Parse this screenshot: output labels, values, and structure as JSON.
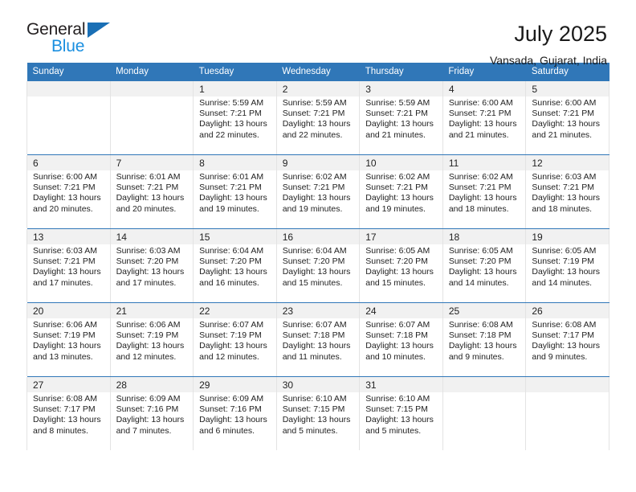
{
  "brand": {
    "name_part1": "General",
    "name_part2": "Blue",
    "triangle_color": "#1a6fb5",
    "blue_color": "#1a8fe0"
  },
  "header": {
    "title": "July 2025",
    "subtitle": "Vansada, Gujarat, India"
  },
  "theme": {
    "header_blue": "#3077b8",
    "daynum_background": "#f1f1f1",
    "cell_border": "#e3e3e3"
  },
  "weekdays": [
    "Sunday",
    "Monday",
    "Tuesday",
    "Wednesday",
    "Thursday",
    "Friday",
    "Saturday"
  ],
  "weeks": [
    {
      "days": [
        {
          "num": "",
          "lines": [
            "",
            "",
            "",
            ""
          ]
        },
        {
          "num": "",
          "lines": [
            "",
            "",
            "",
            ""
          ]
        },
        {
          "num": "1",
          "lines": [
            "Sunrise: 5:59 AM",
            "Sunset: 7:21 PM",
            "Daylight: 13 hours",
            "and 22 minutes."
          ]
        },
        {
          "num": "2",
          "lines": [
            "Sunrise: 5:59 AM",
            "Sunset: 7:21 PM",
            "Daylight: 13 hours",
            "and 22 minutes."
          ]
        },
        {
          "num": "3",
          "lines": [
            "Sunrise: 5:59 AM",
            "Sunset: 7:21 PM",
            "Daylight: 13 hours",
            "and 21 minutes."
          ]
        },
        {
          "num": "4",
          "lines": [
            "Sunrise: 6:00 AM",
            "Sunset: 7:21 PM",
            "Daylight: 13 hours",
            "and 21 minutes."
          ]
        },
        {
          "num": "5",
          "lines": [
            "Sunrise: 6:00 AM",
            "Sunset: 7:21 PM",
            "Daylight: 13 hours",
            "and 21 minutes."
          ]
        }
      ]
    },
    {
      "days": [
        {
          "num": "6",
          "lines": [
            "Sunrise: 6:00 AM",
            "Sunset: 7:21 PM",
            "Daylight: 13 hours",
            "and 20 minutes."
          ]
        },
        {
          "num": "7",
          "lines": [
            "Sunrise: 6:01 AM",
            "Sunset: 7:21 PM",
            "Daylight: 13 hours",
            "and 20 minutes."
          ]
        },
        {
          "num": "8",
          "lines": [
            "Sunrise: 6:01 AM",
            "Sunset: 7:21 PM",
            "Daylight: 13 hours",
            "and 19 minutes."
          ]
        },
        {
          "num": "9",
          "lines": [
            "Sunrise: 6:02 AM",
            "Sunset: 7:21 PM",
            "Daylight: 13 hours",
            "and 19 minutes."
          ]
        },
        {
          "num": "10",
          "lines": [
            "Sunrise: 6:02 AM",
            "Sunset: 7:21 PM",
            "Daylight: 13 hours",
            "and 19 minutes."
          ]
        },
        {
          "num": "11",
          "lines": [
            "Sunrise: 6:02 AM",
            "Sunset: 7:21 PM",
            "Daylight: 13 hours",
            "and 18 minutes."
          ]
        },
        {
          "num": "12",
          "lines": [
            "Sunrise: 6:03 AM",
            "Sunset: 7:21 PM",
            "Daylight: 13 hours",
            "and 18 minutes."
          ]
        }
      ]
    },
    {
      "days": [
        {
          "num": "13",
          "lines": [
            "Sunrise: 6:03 AM",
            "Sunset: 7:21 PM",
            "Daylight: 13 hours",
            "and 17 minutes."
          ]
        },
        {
          "num": "14",
          "lines": [
            "Sunrise: 6:03 AM",
            "Sunset: 7:20 PM",
            "Daylight: 13 hours",
            "and 17 minutes."
          ]
        },
        {
          "num": "15",
          "lines": [
            "Sunrise: 6:04 AM",
            "Sunset: 7:20 PM",
            "Daylight: 13 hours",
            "and 16 minutes."
          ]
        },
        {
          "num": "16",
          "lines": [
            "Sunrise: 6:04 AM",
            "Sunset: 7:20 PM",
            "Daylight: 13 hours",
            "and 15 minutes."
          ]
        },
        {
          "num": "17",
          "lines": [
            "Sunrise: 6:05 AM",
            "Sunset: 7:20 PM",
            "Daylight: 13 hours",
            "and 15 minutes."
          ]
        },
        {
          "num": "18",
          "lines": [
            "Sunrise: 6:05 AM",
            "Sunset: 7:20 PM",
            "Daylight: 13 hours",
            "and 14 minutes."
          ]
        },
        {
          "num": "19",
          "lines": [
            "Sunrise: 6:05 AM",
            "Sunset: 7:19 PM",
            "Daylight: 13 hours",
            "and 14 minutes."
          ]
        }
      ]
    },
    {
      "days": [
        {
          "num": "20",
          "lines": [
            "Sunrise: 6:06 AM",
            "Sunset: 7:19 PM",
            "Daylight: 13 hours",
            "and 13 minutes."
          ]
        },
        {
          "num": "21",
          "lines": [
            "Sunrise: 6:06 AM",
            "Sunset: 7:19 PM",
            "Daylight: 13 hours",
            "and 12 minutes."
          ]
        },
        {
          "num": "22",
          "lines": [
            "Sunrise: 6:07 AM",
            "Sunset: 7:19 PM",
            "Daylight: 13 hours",
            "and 12 minutes."
          ]
        },
        {
          "num": "23",
          "lines": [
            "Sunrise: 6:07 AM",
            "Sunset: 7:18 PM",
            "Daylight: 13 hours",
            "and 11 minutes."
          ]
        },
        {
          "num": "24",
          "lines": [
            "Sunrise: 6:07 AM",
            "Sunset: 7:18 PM",
            "Daylight: 13 hours",
            "and 10 minutes."
          ]
        },
        {
          "num": "25",
          "lines": [
            "Sunrise: 6:08 AM",
            "Sunset: 7:18 PM",
            "Daylight: 13 hours",
            "and 9 minutes."
          ]
        },
        {
          "num": "26",
          "lines": [
            "Sunrise: 6:08 AM",
            "Sunset: 7:17 PM",
            "Daylight: 13 hours",
            "and 9 minutes."
          ]
        }
      ]
    },
    {
      "days": [
        {
          "num": "27",
          "lines": [
            "Sunrise: 6:08 AM",
            "Sunset: 7:17 PM",
            "Daylight: 13 hours",
            "and 8 minutes."
          ]
        },
        {
          "num": "28",
          "lines": [
            "Sunrise: 6:09 AM",
            "Sunset: 7:16 PM",
            "Daylight: 13 hours",
            "and 7 minutes."
          ]
        },
        {
          "num": "29",
          "lines": [
            "Sunrise: 6:09 AM",
            "Sunset: 7:16 PM",
            "Daylight: 13 hours",
            "and 6 minutes."
          ]
        },
        {
          "num": "30",
          "lines": [
            "Sunrise: 6:10 AM",
            "Sunset: 7:15 PM",
            "Daylight: 13 hours",
            "and 5 minutes."
          ]
        },
        {
          "num": "31",
          "lines": [
            "Sunrise: 6:10 AM",
            "Sunset: 7:15 PM",
            "Daylight: 13 hours",
            "and 5 minutes."
          ]
        },
        {
          "num": "",
          "lines": [
            "",
            "",
            "",
            ""
          ]
        },
        {
          "num": "",
          "lines": [
            "",
            "",
            "",
            ""
          ]
        }
      ]
    }
  ]
}
